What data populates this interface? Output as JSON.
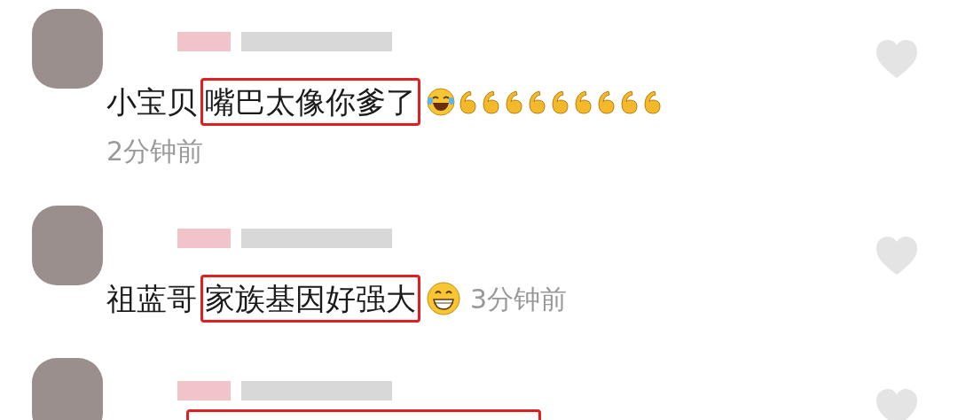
{
  "comments": [
    {
      "prefix": "小宝贝",
      "highlight": "嘴巴太像你爹了",
      "boxed": true,
      "emojis": [
        {
          "kind": "laugh"
        },
        {
          "kind": "six"
        },
        {
          "kind": "six"
        },
        {
          "kind": "six"
        },
        {
          "kind": "six"
        },
        {
          "kind": "six"
        },
        {
          "kind": "six"
        },
        {
          "kind": "six"
        },
        {
          "kind": "six"
        },
        {
          "kind": "six"
        }
      ],
      "time": "2分钟前",
      "time_inline": false
    },
    {
      "prefix": "祖蓝哥",
      "highlight": "家族基因好强大",
      "boxed": true,
      "emojis": [
        {
          "kind": "grin"
        }
      ],
      "time": "3分钟前",
      "time_inline": true
    },
    {
      "boxed": true
    }
  ]
}
